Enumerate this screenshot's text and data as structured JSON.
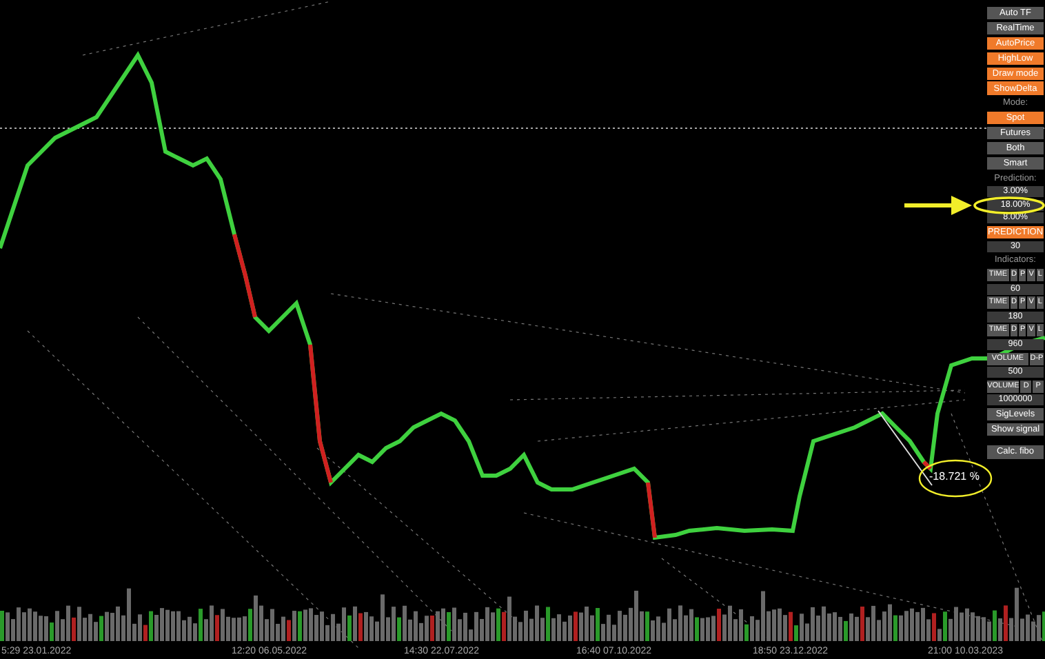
{
  "panel": {
    "items": [
      {
        "kind": "toggle",
        "label": "Auto TF",
        "on": false
      },
      {
        "kind": "toggle",
        "label": "RealTime",
        "on": false
      },
      {
        "kind": "toggle",
        "label": "AutoPrice",
        "on": true
      },
      {
        "kind": "toggle",
        "label": "HighLow",
        "on": true
      },
      {
        "kind": "toggle",
        "label": "Draw mode",
        "on": true
      },
      {
        "kind": "toggle",
        "label": "ShowDelta",
        "on": true
      },
      {
        "kind": "label",
        "label": "Mode:"
      },
      {
        "kind": "toggle",
        "label": "Spot",
        "on": true
      },
      {
        "kind": "toggle",
        "label": "Futures",
        "on": false
      },
      {
        "kind": "toggle",
        "label": "Both",
        "on": false
      },
      {
        "kind": "toggle",
        "label": "Smart",
        "on": false
      },
      {
        "kind": "label",
        "label": "Prediction:"
      },
      {
        "kind": "value",
        "label": "3.00%"
      },
      {
        "kind": "value",
        "label": "18.00%"
      },
      {
        "kind": "value",
        "label": "8.00%"
      },
      {
        "kind": "toggle",
        "label": "PREDICTION",
        "on": true
      },
      {
        "kind": "value",
        "label": "30"
      },
      {
        "kind": "label",
        "label": "Indicators:"
      },
      {
        "kind": "segments",
        "labels": [
          "TIME",
          "D",
          "P",
          "V",
          "L"
        ]
      },
      {
        "kind": "value",
        "label": "60"
      },
      {
        "kind": "segments",
        "labels": [
          "TIME",
          "D",
          "P",
          "V",
          "L"
        ]
      },
      {
        "kind": "value",
        "label": "180"
      },
      {
        "kind": "segments",
        "labels": [
          "TIME",
          "D",
          "P",
          "V",
          "L"
        ]
      },
      {
        "kind": "value",
        "label": "960"
      },
      {
        "kind": "segments",
        "labels": [
          "VOLUME",
          "D-P"
        ]
      },
      {
        "kind": "value",
        "label": "500"
      },
      {
        "kind": "segments",
        "labels": [
          "VOLUME",
          "D",
          "P"
        ]
      },
      {
        "kind": "value",
        "label": "1000000"
      },
      {
        "kind": "toggle",
        "label": "SigLevels",
        "on": false
      },
      {
        "kind": "toggle",
        "label": "Show signal",
        "on": false
      },
      {
        "kind": "spacer"
      },
      {
        "kind": "toggle",
        "label": "Calc. fibo",
        "on": false
      }
    ]
  },
  "annotation": {
    "text": "-18.721 %"
  },
  "time_axis": [
    "5:29 23.01.2022",
    "12:20 06.05.2022",
    "14:30 22.07.2022",
    "16:40 07.10.2022",
    "18:50 23.12.2022",
    "21:00 10.03.2023"
  ]
}
